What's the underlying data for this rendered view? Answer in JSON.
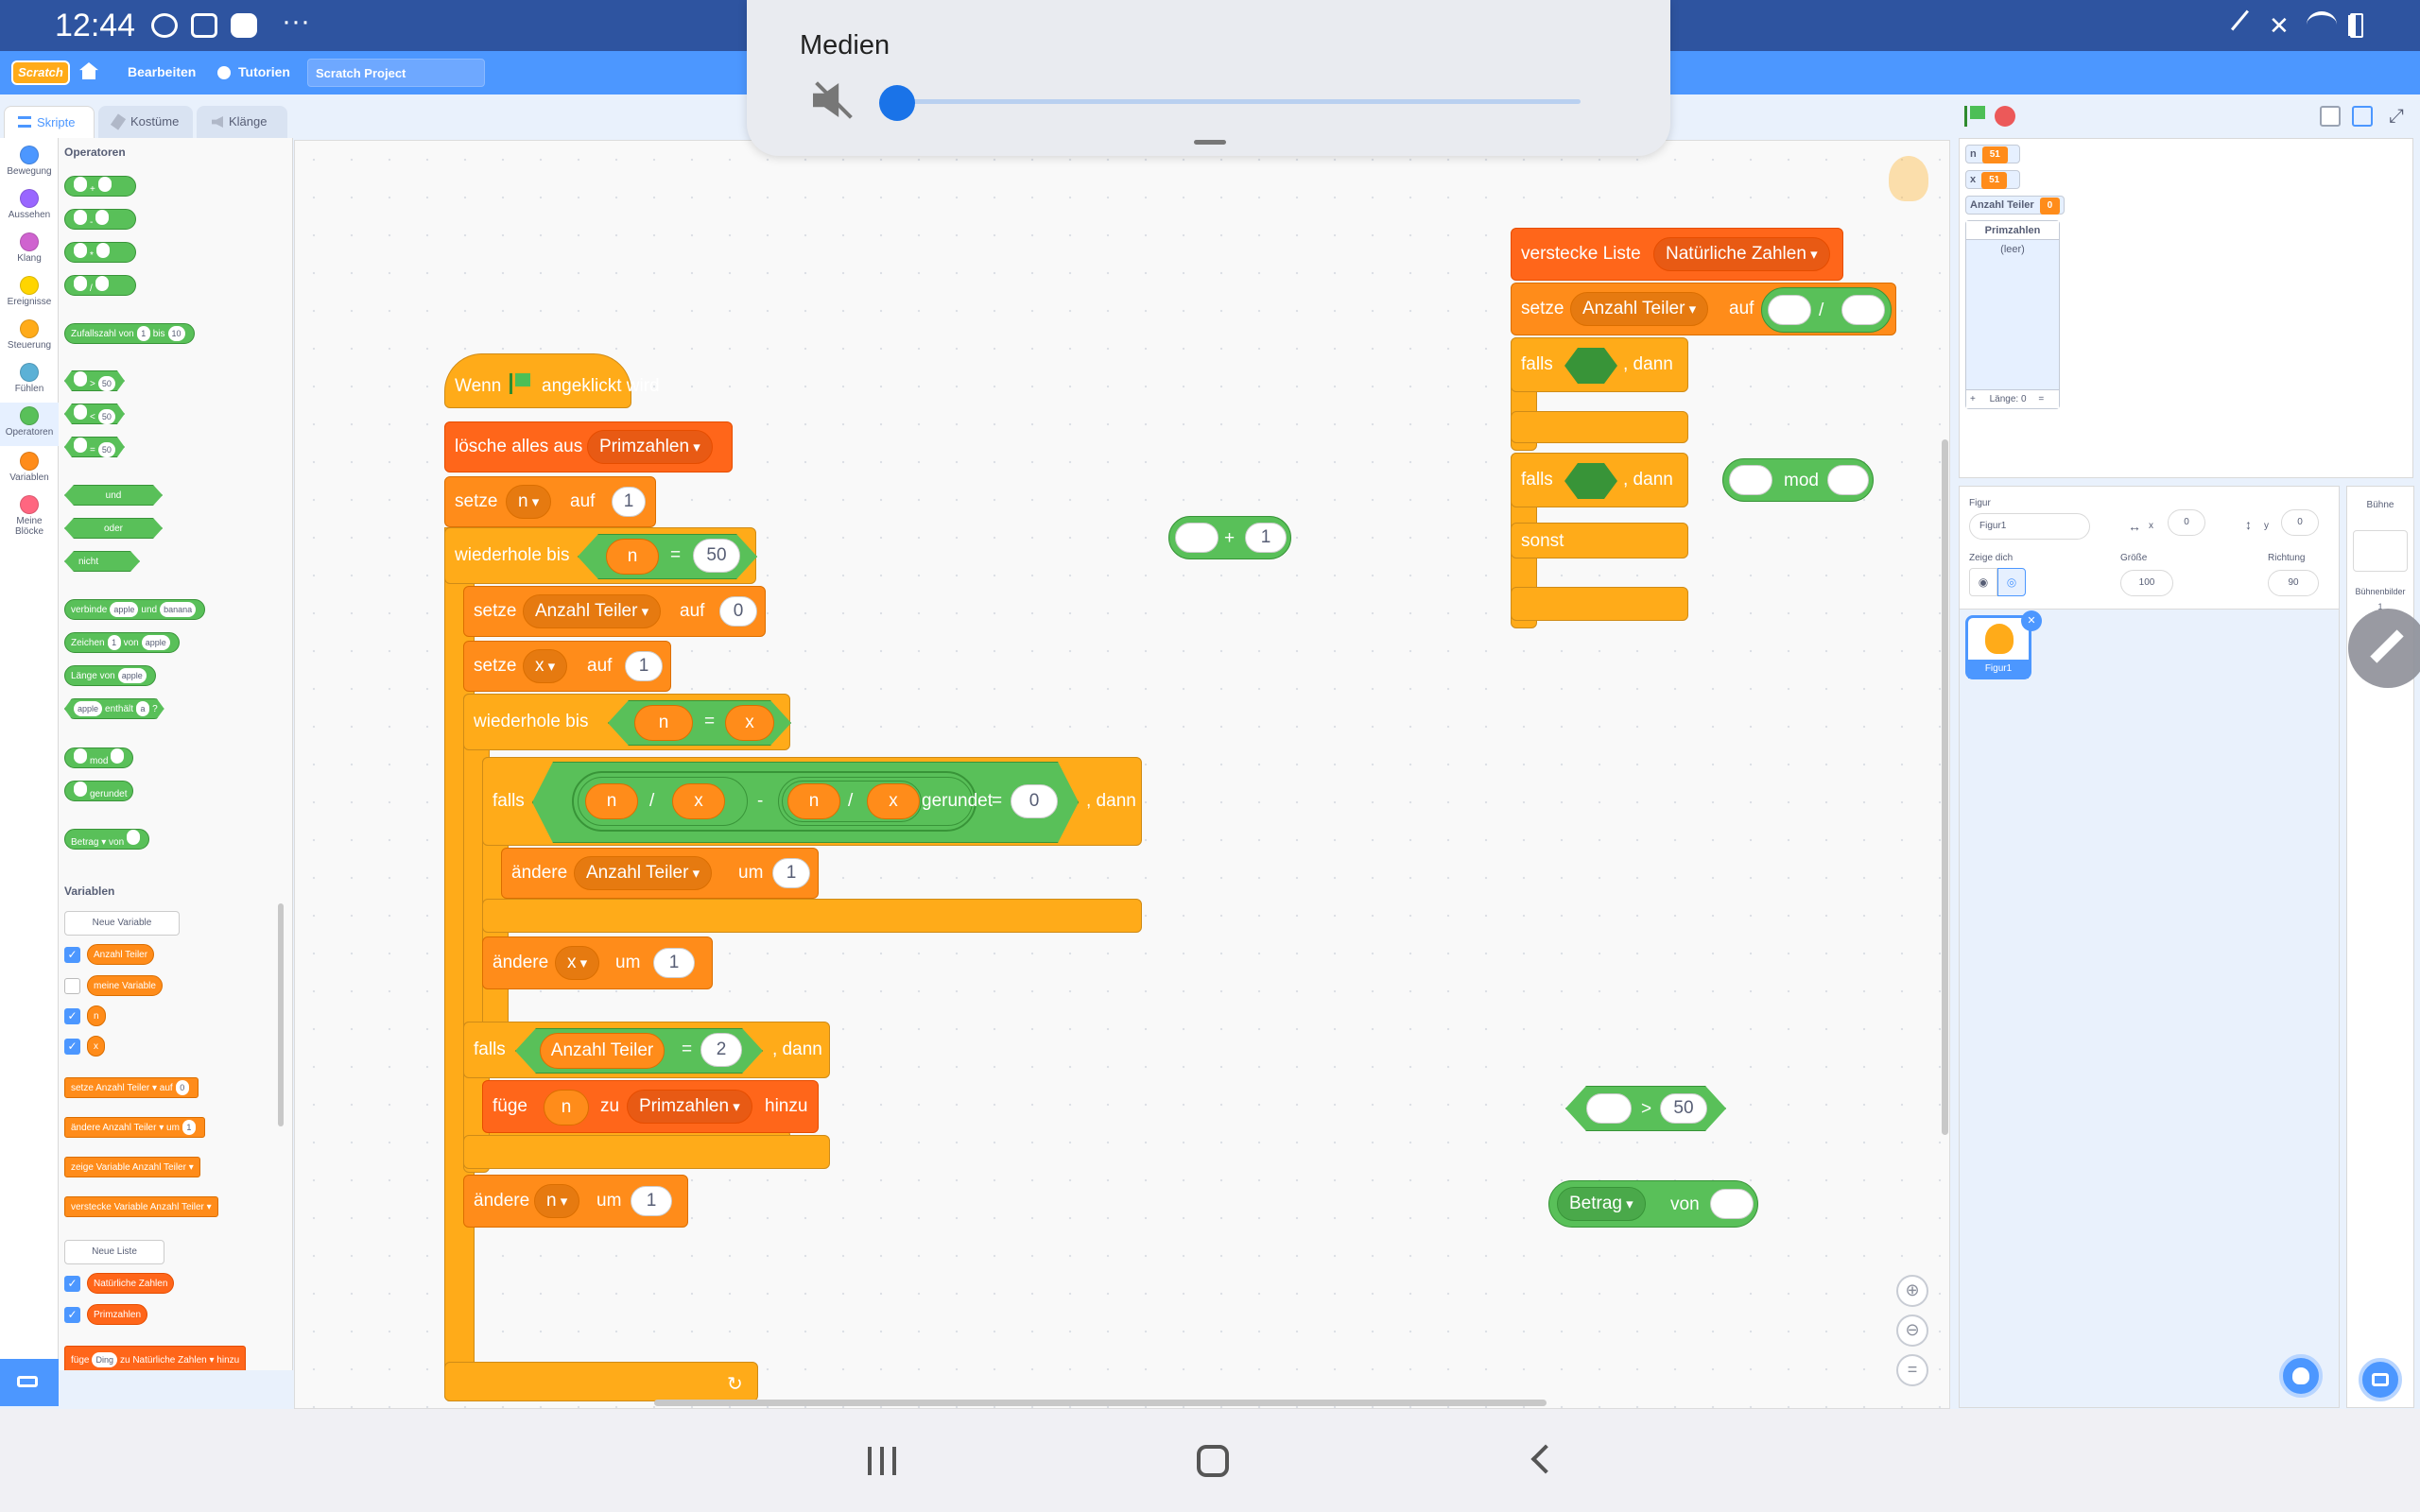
{
  "status_bar": {
    "time": "12:44",
    "more": "···"
  },
  "menu": {
    "logo": "Scratch",
    "edit": "Bearbeiten",
    "tutorials": "Tutorien",
    "project_title": "Scratch Project"
  },
  "media_panel": {
    "title": "Medien",
    "volume_percent": 0
  },
  "tabs": {
    "scripts": "Skripte",
    "costumes": "Kostüme",
    "sounds": "Klänge"
  },
  "categories": [
    {
      "label": "Bewegung",
      "color": "#4c97ff"
    },
    {
      "label": "Aussehen",
      "color": "#9966ff"
    },
    {
      "label": "Klang",
      "color": "#cf63cf"
    },
    {
      "label": "Ereignisse",
      "color": "#ffd500"
    },
    {
      "label": "Steuerung",
      "color": "#ffab19"
    },
    {
      "label": "Fühlen",
      "color": "#5cb1d6"
    },
    {
      "label": "Operatoren",
      "color": "#59c059"
    },
    {
      "label": "Variablen",
      "color": "#ff8c1a"
    },
    {
      "label": "Meine Blöcke",
      "color": "#ff6680"
    }
  ],
  "palette": {
    "operators_heading": "Operatoren",
    "ops": [
      "+",
      "-",
      "*",
      "/"
    ],
    "random": {
      "a": "Zufallszahl von",
      "from": "1",
      "b": "bis",
      "to": "10"
    },
    "compare": [
      {
        "op": ">",
        "v": "50"
      },
      {
        "op": "<",
        "v": "50"
      },
      {
        "op": "=",
        "v": "50"
      }
    ],
    "logic": [
      "und",
      "oder",
      "nicht"
    ],
    "join": {
      "label": "verbinde",
      "a": "apple",
      "and": "und",
      "b": "banana"
    },
    "letter": {
      "label": "Zeichen",
      "n": "1",
      "of": "von",
      "s": "apple"
    },
    "length": {
      "label": "Länge von",
      "s": "apple"
    },
    "contains": {
      "s": "apple",
      "label": "enthält",
      "c": "a",
      "q": "?"
    },
    "mod": "mod",
    "round": "gerundet",
    "abs": {
      "label": "Betrag",
      "of": "von"
    },
    "variables_heading": "Variablen",
    "new_variable": "Neue Variable",
    "variables": [
      {
        "name": "Anzahl Teiler",
        "checked": true
      },
      {
        "name": "meine Variable",
        "checked": false
      },
      {
        "name": "n",
        "checked": true
      },
      {
        "name": "x",
        "checked": true
      }
    ],
    "set_block": {
      "a": "setze",
      "var": "Anzahl Teiler",
      "to": "auf",
      "v": "0"
    },
    "change_block": {
      "a": "ändere",
      "var": "Anzahl Teiler",
      "by": "um",
      "v": "1"
    },
    "show_block": {
      "a": "zeige Variable",
      "var": "Anzahl Teiler"
    },
    "hide_block": {
      "a": "verstecke Variable",
      "var": "Anzahl Teiler"
    },
    "new_list": "Neue Liste",
    "lists": [
      {
        "name": "Natürliche Zahlen",
        "checked": true
      },
      {
        "name": "Primzahlen",
        "checked": true
      }
    ],
    "add_block": {
      "a": "füge",
      "thing": "Ding",
      "to": "zu",
      "list": "Natürliche Zahlen",
      "end": "hinzu"
    }
  },
  "script": {
    "hat": {
      "when": "Wenn",
      "clicked": "angeklickt wird"
    },
    "delete_all": {
      "label": "lösche alles aus",
      "list": "Primzahlen"
    },
    "set_n": {
      "label": "setze",
      "var": "n",
      "to": "auf",
      "value": "1"
    },
    "repeat_until_1": {
      "label": "wiederhole bis",
      "a": "n",
      "op": "=",
      "b": "50"
    },
    "set_teiler": {
      "label": "setze",
      "var": "Anzahl Teiler",
      "to": "auf",
      "value": "0"
    },
    "set_x": {
      "label": "setze",
      "var": "x",
      "to": "auf",
      "value": "1"
    },
    "repeat_until_2": {
      "label": "wiederhole bis",
      "a": "n",
      "op": "=",
      "b": "x"
    },
    "if_1": {
      "label": "falls",
      "n1": "n",
      "div1": "/",
      "x1": "x",
      "minus": "-",
      "n2": "n",
      "div2": "/",
      "x2": "x",
      "round": "gerundet",
      "eq": "=",
      "zero": "0",
      "then": ", dann"
    },
    "change_teiler": {
      "label": "ändere",
      "var": "Anzahl Teiler",
      "by": "um",
      "value": "1"
    },
    "change_x": {
      "label": "ändere",
      "var": "x",
      "by": "um",
      "value": "1"
    },
    "if_2": {
      "label": "falls",
      "var": "Anzahl Teiler",
      "eq": "=",
      "value": "2",
      "then": ", dann"
    },
    "add_to": {
      "label": "füge",
      "var": "n",
      "to": "zu",
      "list": "Primzahlen",
      "end": "hinzu"
    },
    "change_n": {
      "label": "ändere",
      "var": "n",
      "by": "um",
      "value": "1"
    }
  },
  "loose_blocks": {
    "add_op": {
      "op": "+",
      "b": "1"
    },
    "hide_list": {
      "label": "verstecke Liste",
      "list": "Natürliche Zahlen"
    },
    "set_div": {
      "label": "setze",
      "var": "Anzahl Teiler",
      "to": "auf",
      "op": "/"
    },
    "if_a": {
      "label": "falls",
      "then": ", dann"
    },
    "if_b": {
      "label": "falls",
      "then": ", dann",
      "else": "sonst"
    },
    "mod": "mod",
    "gt": {
      "op": ">",
      "v": "50"
    },
    "abs": {
      "var": "Betrag",
      "of": "von"
    }
  },
  "stage_monitors": [
    {
      "name": "n",
      "value": "51"
    },
    {
      "name": "x",
      "value": "51"
    },
    {
      "name": "Anzahl Teiler",
      "value": "0"
    }
  ],
  "list_monitor": {
    "title": "Primzahlen",
    "empty": "(leer)",
    "plus": "+",
    "length": "Länge: 0",
    "resize": "="
  },
  "sprite_info": {
    "sprite_label": "Figur",
    "sprite_name": "Figur1",
    "x_label": "x",
    "x": "0",
    "y_label": "y",
    "y": "0",
    "show_label": "Zeige dich",
    "size_label": "Größe",
    "size": "100",
    "direction_label": "Richtung",
    "direction": "90"
  },
  "sprites": [
    {
      "name": "Figur1"
    }
  ],
  "stage_pane": {
    "label": "Bühne",
    "backdrops": "Bühnenbilder",
    "count": "1"
  }
}
